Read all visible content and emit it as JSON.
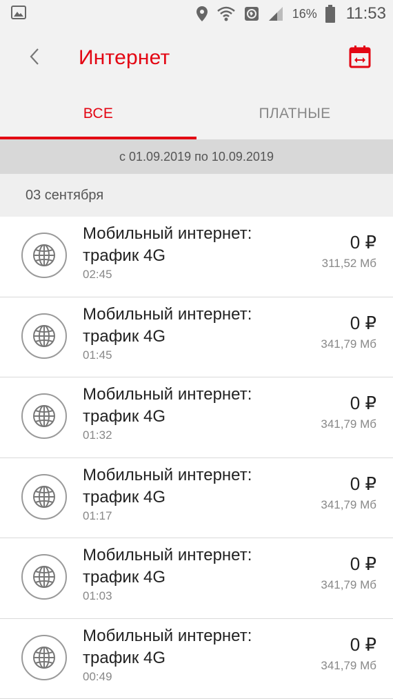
{
  "status_bar": {
    "battery": "16%",
    "time": "11:53"
  },
  "header": {
    "title": "Интернет",
    "back_icon": "chevron-left-icon",
    "calendar_icon": "calendar-icon"
  },
  "tabs": [
    {
      "label": "ВСЕ",
      "active": true
    },
    {
      "label": "ПЛАТНЫЕ",
      "active": false
    }
  ],
  "period": "с 01.09.2019 по 10.09.2019",
  "date_group": "03 сентября",
  "accent_color": "#e30613",
  "items": [
    {
      "icon": "globe-icon",
      "title": "Мобильный интернет: трафик 4G",
      "time": "02:45",
      "amount": "0 ₽",
      "volume": "311,52 Мб"
    },
    {
      "icon": "globe-icon",
      "title": "Мобильный интернет: трафик 4G",
      "time": "01:45",
      "amount": "0 ₽",
      "volume": "341,79 Мб"
    },
    {
      "icon": "globe-icon",
      "title": "Мобильный интернет: трафик 4G",
      "time": "01:32",
      "amount": "0 ₽",
      "volume": "341,79 Мб"
    },
    {
      "icon": "globe-icon",
      "title": "Мобильный интернет: трафик 4G",
      "time": "01:17",
      "amount": "0 ₽",
      "volume": "341,79 Мб"
    },
    {
      "icon": "globe-icon",
      "title": "Мобильный интернет: трафик 4G",
      "time": "01:03",
      "amount": "0 ₽",
      "volume": "341,79 Мб"
    },
    {
      "icon": "globe-icon",
      "title": "Мобильный интернет: трафик 4G",
      "time": "00:49",
      "amount": "0 ₽",
      "volume": "341,79 Мб"
    }
  ]
}
